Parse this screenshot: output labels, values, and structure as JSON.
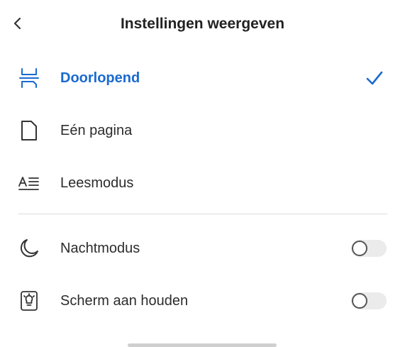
{
  "header": {
    "title": "Instellingen weergeven",
    "back_icon": "chevron-left-icon"
  },
  "view_modes": [
    {
      "label": "Doorlopend",
      "icon": "continuous-scroll-icon",
      "selected": true
    },
    {
      "label": "Eén pagina",
      "icon": "single-page-icon",
      "selected": false
    },
    {
      "label": "Leesmodus",
      "icon": "reading-mode-icon",
      "selected": false
    }
  ],
  "toggles": [
    {
      "label": "Nachtmodus",
      "icon": "moon-icon",
      "on": false
    },
    {
      "label": "Scherm aan houden",
      "icon": "lightbulb-icon",
      "on": false
    }
  ],
  "colors": {
    "accent": "#1a6ad0",
    "text": "#2c2c2c",
    "divider": "#dcdcdc",
    "toggle_track": "#ebebeb"
  }
}
